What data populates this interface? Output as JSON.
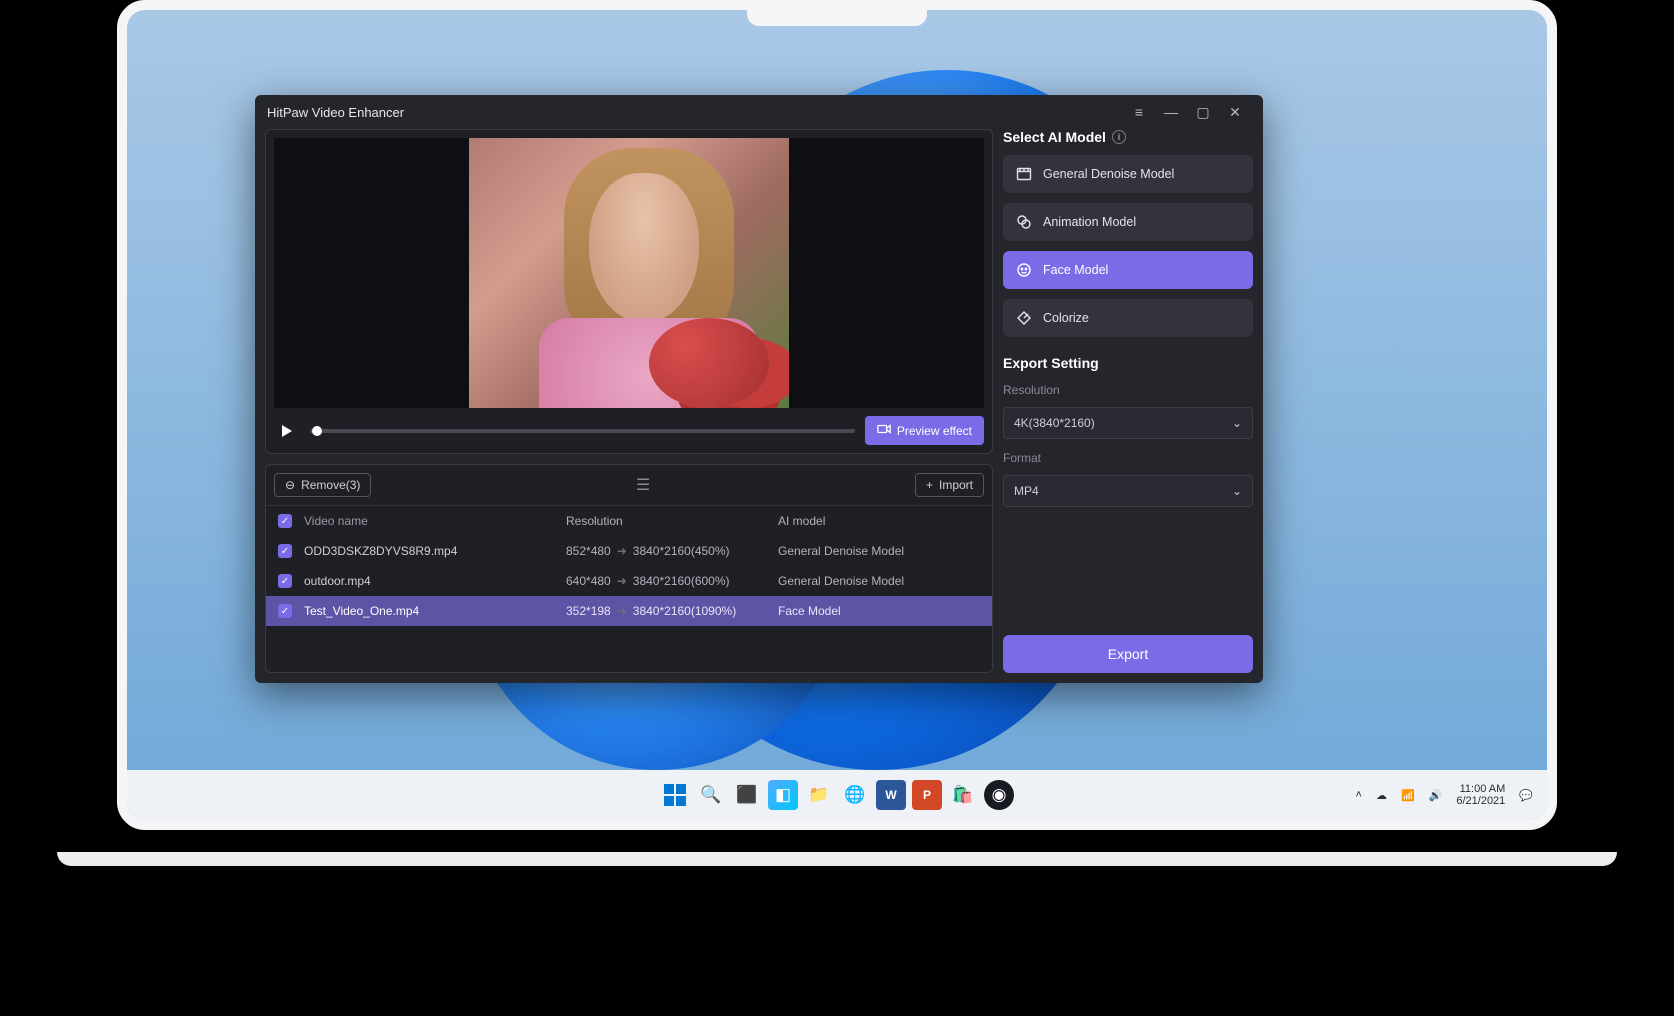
{
  "app": {
    "title": "HitPaw Video Enhancer",
    "preview_effect": "Preview effect",
    "remove_label": "Remove(3)",
    "import_label": "Import",
    "columns": {
      "name": "Video name",
      "resolution": "Resolution",
      "ai": "AI model"
    },
    "files": [
      {
        "name": "ODD3DSKZ8DYVS8R9.mp4",
        "src": "852*480",
        "dst": "3840*2160(450%)",
        "ai": "General Denoise Model",
        "selected": false
      },
      {
        "name": "outdoor.mp4",
        "src": "640*480",
        "dst": "3840*2160(600%)",
        "ai": "General Denoise Model",
        "selected": false
      },
      {
        "name": "Test_Video_One.mp4",
        "src": "352*198",
        "dst": "3840*2160(1090%)",
        "ai": "Face Model",
        "selected": true
      }
    ]
  },
  "sidebar": {
    "select_model": "Select AI Model",
    "models": [
      {
        "label": "General Denoise Model",
        "selected": false
      },
      {
        "label": "Animation Model",
        "selected": false
      },
      {
        "label": "Face Model",
        "selected": true
      },
      {
        "label": "Colorize",
        "selected": false
      }
    ],
    "export_setting": "Export Setting",
    "resolution_label": "Resolution",
    "resolution_value": "4K(3840*2160)",
    "format_label": "Format",
    "format_value": "MP4",
    "export": "Export"
  },
  "taskbar": {
    "time": "11:00 AM",
    "date": "6/21/2021"
  }
}
